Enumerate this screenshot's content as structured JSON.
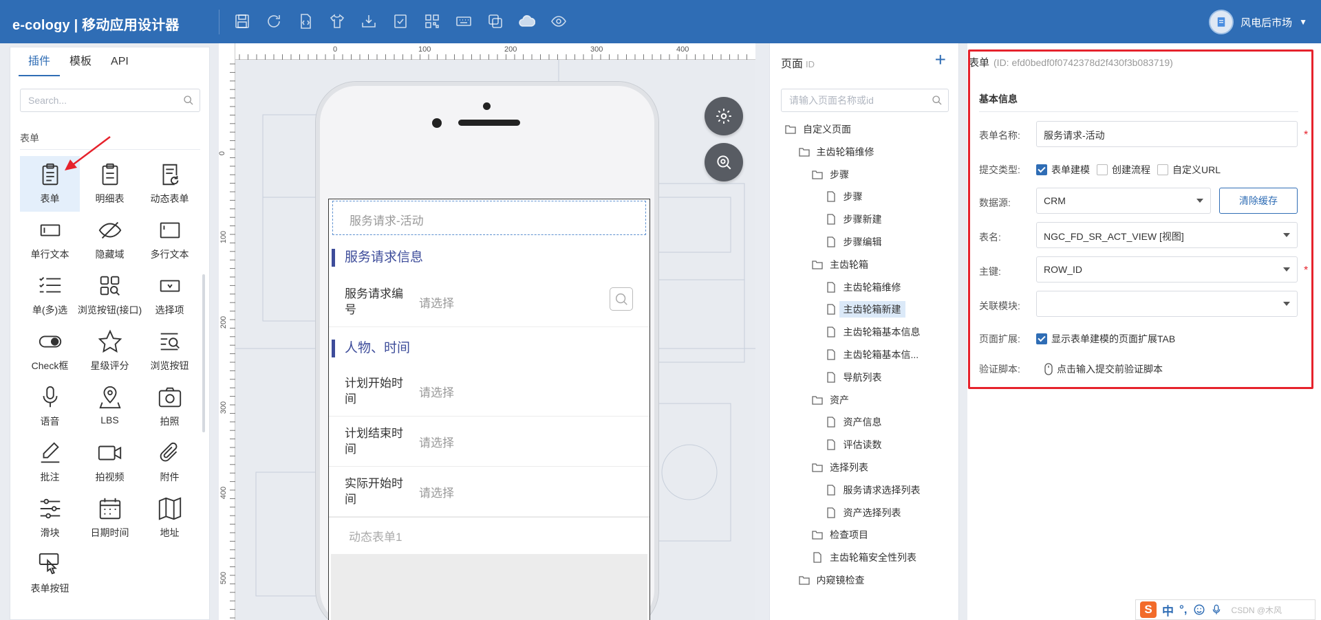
{
  "app": {
    "brand": "e-cology | 移动应用设计器",
    "user_name": "风电后市场"
  },
  "toolbar": {
    "icons": [
      "save-icon",
      "refresh-icon",
      "code-icon",
      "shirt-icon",
      "download-icon",
      "check-icon",
      "qrcode-icon",
      "keyboard-icon",
      "copy-icon",
      "cloud-upload-icon",
      "eye-icon"
    ]
  },
  "left": {
    "tabs": [
      "插件",
      "模板",
      "API"
    ],
    "search_placeholder": "Search...",
    "group_label": "表单",
    "plugins": [
      "表单",
      "明细表",
      "动态表单",
      "单行文本",
      "隐藏域",
      "多行文本",
      "单(多)选",
      "浏览按钮(接口)",
      "选择项",
      "Check框",
      "星级评分",
      "浏览按钮",
      "语音",
      "LBS",
      "拍照",
      "批注",
      "拍视频",
      "附件",
      "滑块",
      "日期时间",
      "地址",
      "表单按钮"
    ]
  },
  "canvas": {
    "ruler_top": [
      "0",
      "100",
      "200",
      "300",
      "400"
    ],
    "ruler_left": [
      "0",
      "100",
      "200",
      "300",
      "400",
      "500"
    ]
  },
  "phone": {
    "form_title": "服务请求-活动",
    "section1": "服务请求信息",
    "field1_label": "服务请求编号",
    "field1_value": "请选择",
    "section2": "人物、时间",
    "field2_label": "计划开始时间",
    "field2_value": "请选择",
    "field3_label": "计划结束时间",
    "field3_value": "请选择",
    "field4_label": "实际开始时间",
    "field4_value": "请选择",
    "dynamic_form": "动态表单1"
  },
  "pages": {
    "title": "页面",
    "title_sub": "ID",
    "add": "+",
    "search_placeholder": "请输入页面名称或id",
    "tree": [
      {
        "label": "自定义页面",
        "type": "folder",
        "depth": 0
      },
      {
        "label": "主齿轮箱维修",
        "type": "folder",
        "depth": 1
      },
      {
        "label": "步骤",
        "type": "folder",
        "depth": 2
      },
      {
        "label": "步骤",
        "type": "file",
        "depth": 3
      },
      {
        "label": "步骤新建",
        "type": "file",
        "depth": 3
      },
      {
        "label": "步骤编辑",
        "type": "file",
        "depth": 3
      },
      {
        "label": "主齿轮箱",
        "type": "folder",
        "depth": 2
      },
      {
        "label": "主齿轮箱维修",
        "type": "file",
        "depth": 3
      },
      {
        "label": "主齿轮箱新建",
        "type": "file",
        "depth": 3,
        "selected": true
      },
      {
        "label": "主齿轮箱基本信息",
        "type": "file",
        "depth": 3
      },
      {
        "label": "主齿轮箱基本信...",
        "type": "file",
        "depth": 3
      },
      {
        "label": "导航列表",
        "type": "file",
        "depth": 3
      },
      {
        "label": "资产",
        "type": "folder",
        "depth": 2
      },
      {
        "label": "资产信息",
        "type": "file",
        "depth": 3
      },
      {
        "label": "评估读数",
        "type": "file",
        "depth": 3
      },
      {
        "label": "选择列表",
        "type": "folder",
        "depth": 2
      },
      {
        "label": "服务请求选择列表",
        "type": "file",
        "depth": 3
      },
      {
        "label": "资产选择列表",
        "type": "file",
        "depth": 3
      },
      {
        "label": "检查项目",
        "type": "folder",
        "depth": 2
      },
      {
        "label": "主齿轮箱安全性列表",
        "type": "file",
        "depth": 2
      },
      {
        "label": "内窥镜检查",
        "type": "folder",
        "depth": 1
      }
    ]
  },
  "props": {
    "title": "表单",
    "id_text": "(ID: efd0bedf0f0742378d2f430f3b083719)",
    "section": "基本信息",
    "form_name_label": "表单名称:",
    "form_name_value": "服务请求-活动",
    "submit_type_label": "提交类型:",
    "submit_opt1": "表单建模",
    "submit_opt2": "创建流程",
    "submit_opt3": "自定义URL",
    "datasource_label": "数据源:",
    "datasource_value": "CRM",
    "clear_cache": "清除缓存",
    "table_label": "表名:",
    "table_value": "NGC_FD_SR_ACT_VIEW [视图]",
    "pk_label": "主键:",
    "pk_value": "ROW_ID",
    "module_label": "关联模块:",
    "module_value": "",
    "ext_label": "页面扩展:",
    "ext_value": "显示表单建模的页面扩展TAB",
    "script_label": "验证脚本:",
    "script_value": "点击输入提交前验证脚本",
    "required_mark": "*"
  },
  "ime": {
    "logo": "S",
    "lang": "中",
    "punct": "°,",
    "watermark": "CSDN @木风"
  },
  "colors": {
    "topbar": "#2f6db5",
    "accent": "#2f6db5",
    "section": "#3d4c9a",
    "highlight": "#e6222c"
  }
}
